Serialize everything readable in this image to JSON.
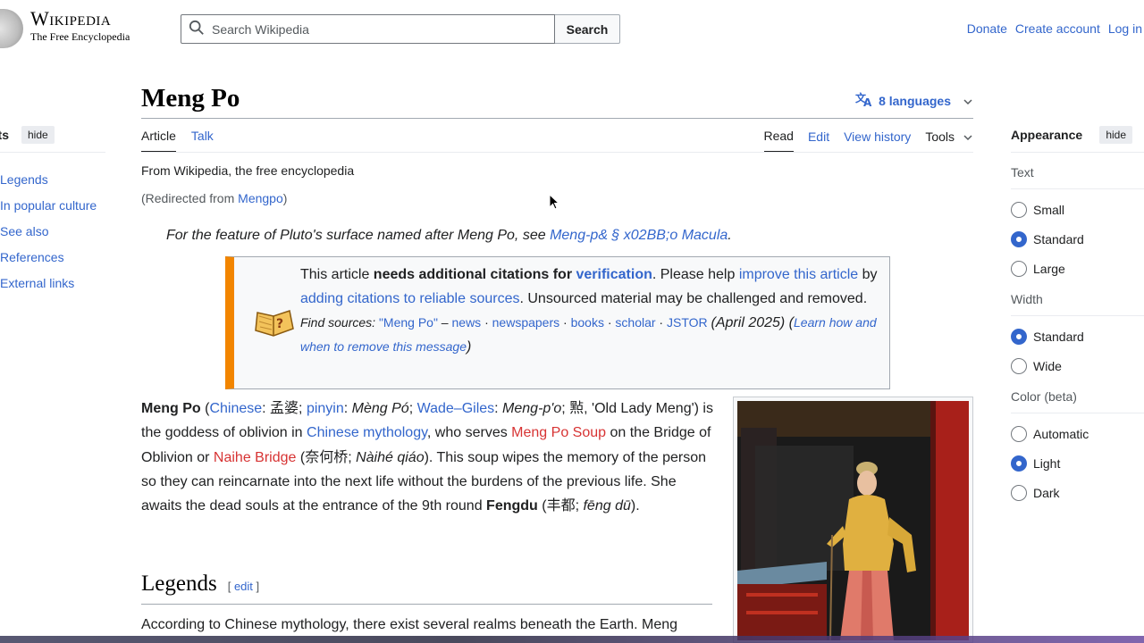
{
  "header": {
    "logo_word": "Wikipedia",
    "logo_tagline": "The Free Encyclopedia",
    "search_placeholder": "Search Wikipedia",
    "search_button": "Search",
    "links": [
      "Donate",
      "Create account",
      "Log in"
    ]
  },
  "toc": {
    "title": "Contents",
    "hide": "hide",
    "items": [
      "Legends",
      "In popular culture",
      "See also",
      "References",
      "External links"
    ]
  },
  "article": {
    "title": "Meng Po",
    "languages": "8 languages",
    "tabs_left": [
      "Article",
      "Talk"
    ],
    "tabs_right": [
      "Read",
      "Edit",
      "View history",
      "Tools"
    ],
    "tagline": "From Wikipedia, the free encyclopedia",
    "redirect_prefix": "(Redirected from ",
    "redirect_link": "Mengpo",
    "redirect_suffix": ")",
    "hatnote_prefix": "For the feature of Pluto's surface named after Meng Po, see ",
    "hatnote_link": "Meng-p& § x02BB;o Macula",
    "hatnote_suffix": "."
  },
  "ambox": {
    "t1": "This article ",
    "t2": "needs additional citations for ",
    "t3": "verification",
    "t4": ". Please help ",
    "t5": "improve this article",
    "t6": "by ",
    "t7": "adding citations to reliable sources",
    "t8": ". Unsourced material may be challenged and removed.",
    "fs_label": "Find sources: ",
    "fs_items": [
      "\"Meng Po\"",
      "news",
      "newspapers",
      "books",
      "scholar",
      "JSTOR"
    ],
    "fs_dash": " – ",
    "fs_dot": " · ",
    "date": "(April 2025)",
    "learn_open": " (",
    "learn": "Learn how and when to remove this message",
    "learn_close": ")"
  },
  "lead": {
    "name": "Meng Po",
    "p1": " (",
    "chinese_link": "Chinese",
    "p2": ": 孟婆; ",
    "pinyin_link": "pinyin",
    "p3": ": ",
    "pinyin": "Mèng Pó",
    "p4": "; ",
    "wg_link": "Wade–Giles",
    "p5": ": ",
    "wg": "Meng-p'o",
    "p6": "; 㸃, 'Old Lady Meng') is the goddess of oblivion in ",
    "myth_link": "Chinese mythology",
    "p7": ", who serves ",
    "soup_link": "Meng Po Soup",
    "p8": " on the Bridge of Oblivion or ",
    "naihe_link": "Naihe Bridge",
    "p9": " (奈何桥; ",
    "naihe_py": "Nàihé qiáo",
    "p10": "). This soup wipes the memory of the person so they can reincarnate into the next life without the burdens of the previous life. She awaits the dead souls at the entrance of the 9th round ",
    "fengdu": "Fengdu",
    "p11": " (丰都; ",
    "fengdu_py": "fēng dū",
    "p12": ")."
  },
  "section": {
    "heading": "Legends",
    "edit_open": "[ ",
    "edit": "edit",
    "edit_close": " ]",
    "text": "According to Chinese mythology, there exist several realms beneath the Earth. Meng"
  },
  "appearance": {
    "title": "Appearance",
    "hide": "hide",
    "text_label": "Text",
    "text_options": [
      "Small",
      "Standard",
      "Large"
    ],
    "text_selected": "Standard",
    "width_label": "Width",
    "width_options": [
      "Standard",
      "Wide"
    ],
    "width_selected": "Standard",
    "color_label": "Color (beta)",
    "color_options": [
      "Automatic",
      "Light",
      "Dark"
    ],
    "color_selected": "Light"
  }
}
